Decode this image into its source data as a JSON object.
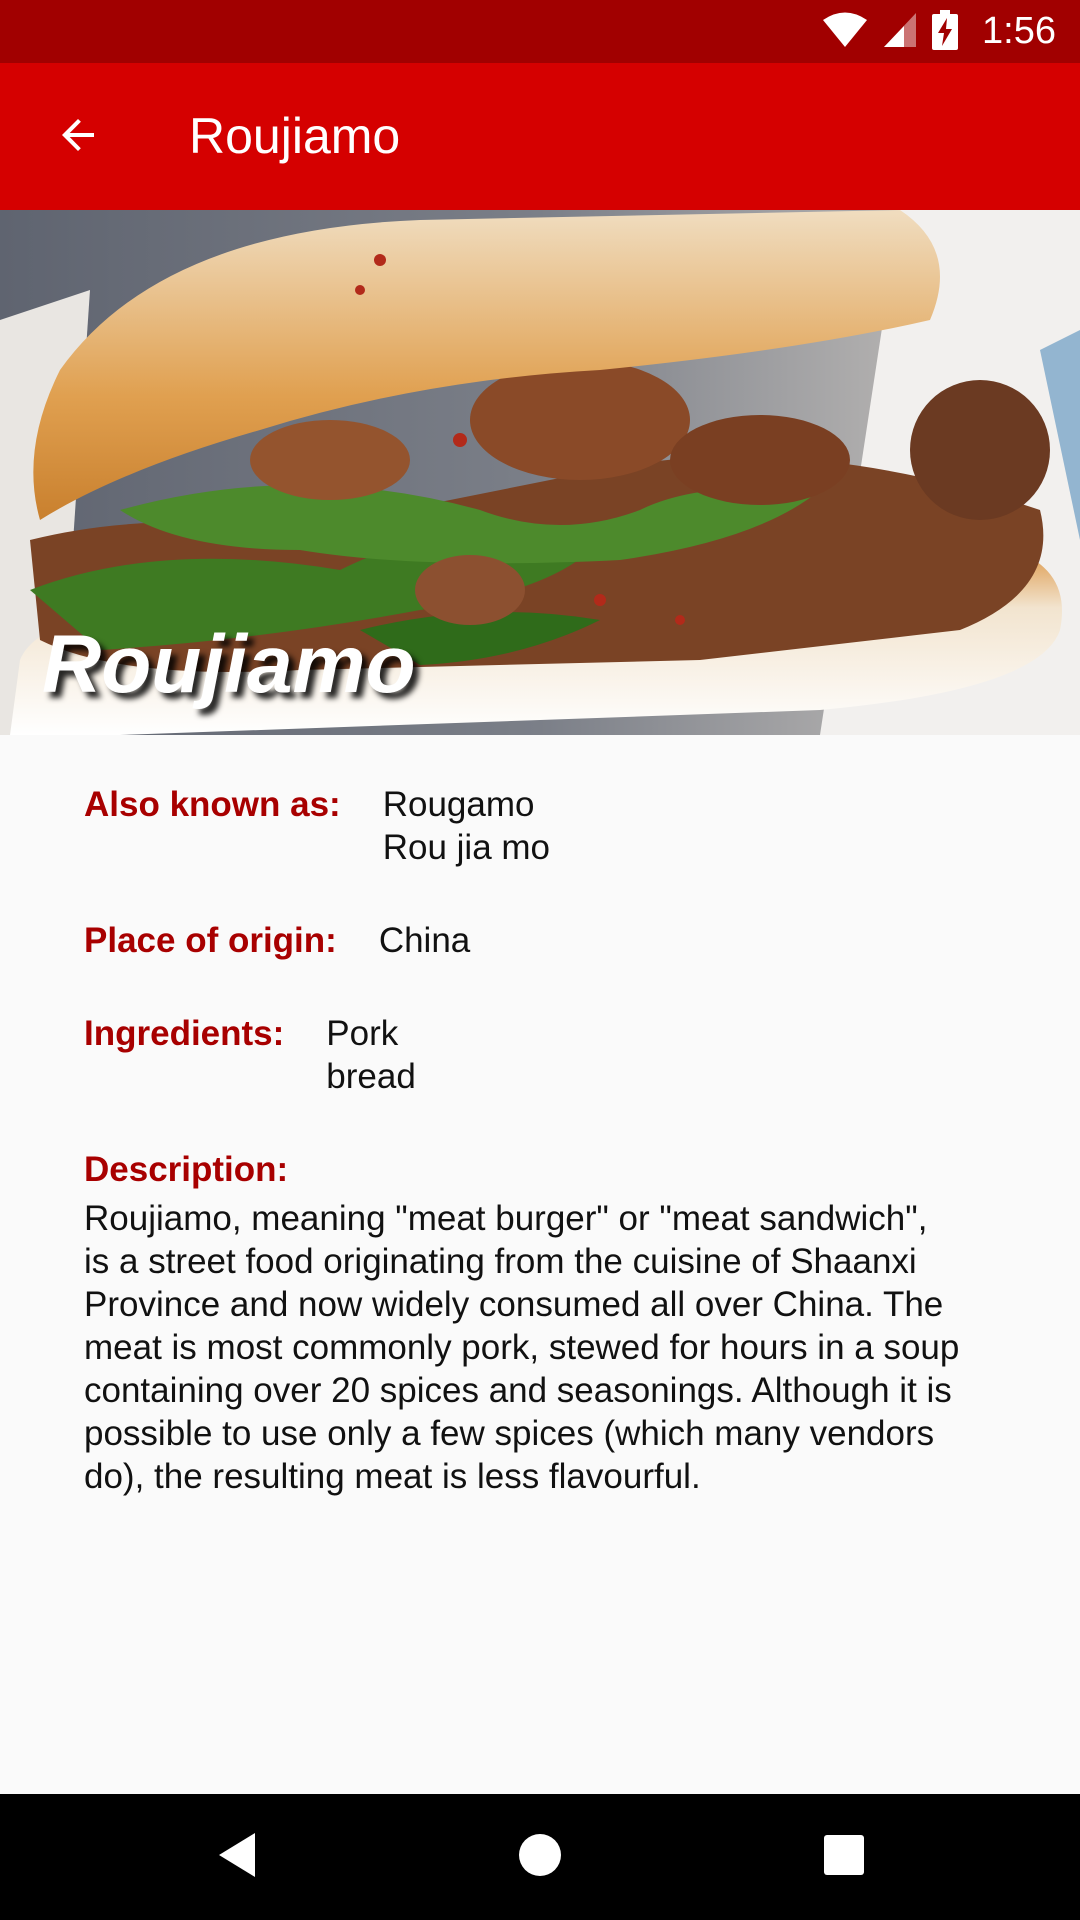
{
  "status_bar": {
    "time": "1:56",
    "icons": [
      "wifi-icon",
      "cellular-signal-icon",
      "battery-charging-icon"
    ]
  },
  "app_bar": {
    "title": "Roujiamo",
    "back_icon": "arrow-back-icon"
  },
  "hero": {
    "caption": "Roujiamo"
  },
  "details": {
    "also_known_as": {
      "label": "Also known as:",
      "values": [
        "Rougamo",
        "Rou jia mo"
      ]
    },
    "place_of_origin": {
      "label": "Place of origin:",
      "value": "China"
    },
    "ingredients": {
      "label": "Ingredients:",
      "values": [
        "Pork",
        "bread"
      ]
    },
    "description": {
      "label": "Description:",
      "lines": [
        "Roujiamo, meaning \"meat burger\" or \"meat sandwich\",",
        "is a street food originating from the cuisine of Shaanxi",
        "Province and now widely consumed all over China. The",
        "meat is most commonly pork, stewed for hours in a soup",
        "containing over 20 spices and seasonings. Although it is",
        "possible to use only a few spices (which many vendors",
        "do), the resulting meat is less flavourful."
      ]
    }
  },
  "nav_bar": {
    "back": "nav-back-icon",
    "home": "nav-home-icon",
    "recents": "nav-recents-icon"
  },
  "colors": {
    "status_bar": "#a10000",
    "app_bar": "#d50000",
    "label": "#a80000",
    "background": "#fafafa",
    "nav_bar": "#000000"
  }
}
